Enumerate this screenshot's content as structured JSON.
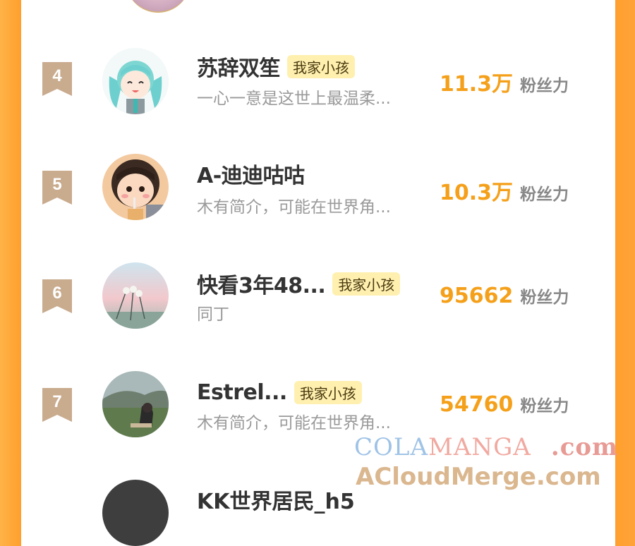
{
  "colors": {
    "accent": "#f5a01a",
    "tag_bg": "#fff0b0",
    "side_bar": "#ff9f2e",
    "rank_badge": "#c9ab8e"
  },
  "rows": [
    {
      "rank": "4",
      "name": "苏辞双笙",
      "tag": "我家小孩",
      "desc": "一心一意是这世上最温柔...",
      "fans_value": "11.3万",
      "fans_unit": "粉丝力",
      "avatar": "anime-girl-avatar"
    },
    {
      "rank": "5",
      "name": "A-迪迪咕咕",
      "tag": "",
      "desc": "木有简介，可能在世界角...",
      "fans_value": "10.3万",
      "fans_unit": "粉丝力",
      "avatar": "child-drinking-avatar"
    },
    {
      "rank": "6",
      "name": "快看3年48...",
      "tag": "我家小孩",
      "desc": "同丁",
      "fans_value": "95662",
      "fans_unit": "粉丝力",
      "avatar": "dandelion-landscape-avatar"
    },
    {
      "rank": "7",
      "name": "Estrel...",
      "tag": "我家小孩",
      "desc": "木有简介，可能在世界角...",
      "fans_value": "54760",
      "fans_unit": "粉丝力",
      "avatar": "girl-in-field-avatar"
    }
  ],
  "next_row": {
    "name": "KK世界居民_h5"
  },
  "watermark": {
    "line1_a": "COLA",
    "line1_b": "MANGA",
    "line1_c": ".com",
    "line2": "ACloudMerge.com"
  }
}
